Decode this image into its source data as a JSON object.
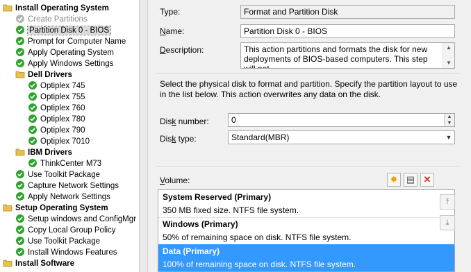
{
  "tree": {
    "items": [
      {
        "label": "Install Operating System",
        "type": "group",
        "indent": 0
      },
      {
        "label": "Create Partitions",
        "type": "disabled",
        "indent": 1
      },
      {
        "label": "Partition Disk 0 - BIOS",
        "type": "step",
        "indent": 1,
        "selected": true
      },
      {
        "label": "Prompt for Computer Name",
        "type": "step",
        "indent": 1
      },
      {
        "label": "Apply Operating System",
        "type": "step",
        "indent": 1
      },
      {
        "label": "Apply Windows Settings",
        "type": "step",
        "indent": 1
      },
      {
        "label": "Dell Drivers",
        "type": "group",
        "indent": 1
      },
      {
        "label": "Optiplex 745",
        "type": "step",
        "indent": 2
      },
      {
        "label": "Optiplex 755",
        "type": "step",
        "indent": 2
      },
      {
        "label": "Optiplex 760",
        "type": "step",
        "indent": 2
      },
      {
        "label": "Optiplex 780",
        "type": "step",
        "indent": 2
      },
      {
        "label": "Optiplex 790",
        "type": "step",
        "indent": 2
      },
      {
        "label": "Optiplex 7010",
        "type": "step",
        "indent": 2
      },
      {
        "label": "IBM Drivers",
        "type": "group",
        "indent": 1
      },
      {
        "label": "ThinkCenter M73",
        "type": "step",
        "indent": 2
      },
      {
        "label": "Use Toolkit Package",
        "type": "step",
        "indent": 1
      },
      {
        "label": "Capture Network Settings",
        "type": "step",
        "indent": 1
      },
      {
        "label": "Apply Network Settings",
        "type": "step",
        "indent": 1
      },
      {
        "label": "Setup Operating System",
        "type": "group",
        "indent": 0
      },
      {
        "label": "Setup windows and ConfigMgr",
        "type": "step",
        "indent": 1
      },
      {
        "label": "Copy Local Group Policy",
        "type": "step",
        "indent": 1
      },
      {
        "label": "Use Toolkit Package",
        "type": "step",
        "indent": 1
      },
      {
        "label": "Install Windows Features",
        "type": "step",
        "indent": 1
      },
      {
        "label": "Install Software",
        "type": "group",
        "indent": 0
      }
    ]
  },
  "props": {
    "type_label_pre": "Type:",
    "type_value": "Format and Partition Disk",
    "name_label_u": "N",
    "name_label_rest": "ame:",
    "name_value": "Partition Disk 0 - BIOS",
    "desc_label_u": "D",
    "desc_label_rest": "escription:",
    "desc_value": "This action partitions and formats the disk for new deployments of BIOS-based computers. This step will not",
    "instructions": "Select the physical disk to format and partition. Specify the partition layout to use in the list below. This action overwrites any data on the disk.",
    "disk_number_label_pre": "Dis",
    "disk_number_label_u": "k",
    "disk_number_label_rest": " number:",
    "disk_number_value": "0",
    "disk_type_label_pre": "Dis",
    "disk_type_label_u": "k",
    "disk_type_label_rest": " type:",
    "disk_type_value": "Standard(MBR)",
    "volume_label_u": "V",
    "volume_label_rest": "olume:"
  },
  "volumes": [
    {
      "title": "System Reserved (Primary)",
      "detail": "350 MB fixed size. NTFS file system.",
      "selected": false
    },
    {
      "title": "Windows (Primary)",
      "detail": "50% of remaining space on disk. NTFS file system.",
      "selected": false
    },
    {
      "title": "Data (Primary)",
      "detail": "100% of remaining space on disk. NTFS file system.",
      "selected": true
    }
  ],
  "icons": {
    "check_color": "#2ea32e",
    "folder_color": "#e8c04a",
    "accent_select": "#3399ff",
    "delete_color": "#d9261c"
  }
}
